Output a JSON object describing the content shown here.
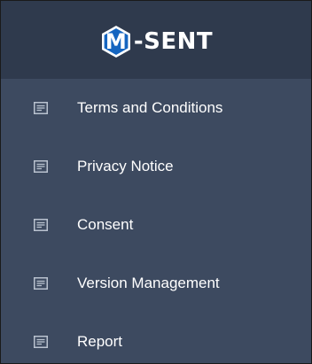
{
  "brand": {
    "logo_letter": "M",
    "logo_rest": "-SENT",
    "logo_hex_color": "#1565c0"
  },
  "menu": {
    "icon": "document-icon",
    "items": [
      {
        "label": "Terms and Conditions"
      },
      {
        "label": "Privacy Notice"
      },
      {
        "label": "Consent"
      },
      {
        "label": "Version Management"
      },
      {
        "label": "Report"
      }
    ]
  },
  "colors": {
    "sidebar_bg": "#3d4a60",
    "header_bg": "#2f3a4d",
    "text": "#ffffff",
    "icon": "#b9c2cf"
  }
}
